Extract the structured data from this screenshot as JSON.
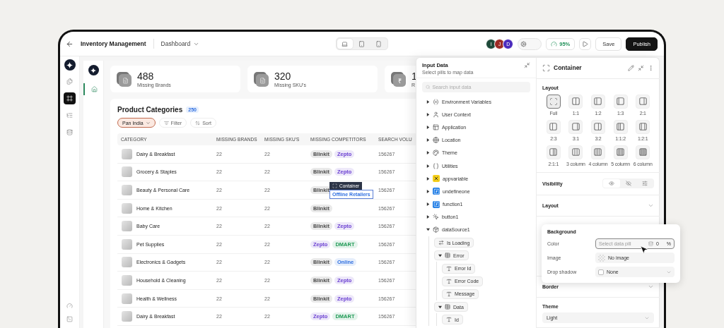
{
  "topbar": {
    "title": "Inventory Management",
    "page": "Dashboard",
    "devices": [
      {
        "selected": true
      },
      {
        "selected": false
      },
      {
        "selected": false
      }
    ],
    "avatars": [
      {
        "initial": "I",
        "color": "#1f4a3a"
      },
      {
        "initial": "J",
        "color": "#9c2a25"
      },
      {
        "initial": "D",
        "color": "#4b2bbd"
      }
    ],
    "settings_toggle_on": false,
    "score": "95%",
    "save": "Save",
    "publish": "Publish"
  },
  "rail": [
    {
      "selected": false
    },
    {
      "selected": true
    },
    {
      "selected": false
    },
    {
      "selected": false
    }
  ],
  "app_nav": [
    {
      "selected": true
    }
  ],
  "stats": [
    {
      "kind": "doc",
      "value": "488",
      "label": "Missing Brands"
    },
    {
      "kind": "doc",
      "value": "320",
      "label": "Missing SKU's"
    },
    {
      "kind": "currency",
      "symbol": "₹",
      "value": "1",
      "label": "R"
    }
  ],
  "table": {
    "title": "Product Categories",
    "count": "250",
    "filters": [
      {
        "kind": "region",
        "label": "Pan India"
      },
      {
        "kind": "filter",
        "label": "Filter"
      },
      {
        "kind": "sort",
        "label": "Sort"
      }
    ],
    "columns": [
      "CATEGORY",
      "MISSING BRANDS",
      "MISSING SKU'S",
      "MISSING COMPETITORS",
      "SEARCH VOLU"
    ],
    "rows": [
      {
        "category": "Dairy & Breakfast",
        "brands": "22",
        "skus": "22",
        "competitors": [
          {
            "name": "Blinkit",
            "color": "#4a4a4a"
          },
          {
            "name": "Zepto",
            "color": "#6a3fd1"
          }
        ],
        "volume": "156267"
      },
      {
        "category": "Grocery & Staples",
        "brands": "22",
        "skus": "22",
        "competitors": [
          {
            "name": "Blinkit",
            "color": "#4a4a4a"
          },
          {
            "name": "Zepto",
            "color": "#6a3fd1"
          }
        ],
        "volume": "156267"
      },
      {
        "category": "Beauty & Personal Care",
        "brands": "22",
        "skus": "22",
        "competitors": [
          {
            "name": "Blinkit",
            "color": "#4a4a4a"
          }
        ],
        "overlay": {
          "label": "Container",
          "tag": "Offline Retailers"
        },
        "volume": "156267"
      },
      {
        "category": "Home & Kitchen",
        "brands": "22",
        "skus": "22",
        "competitors": [
          {
            "name": "Blinkit",
            "color": "#4a4a4a"
          }
        ],
        "volume": "156267"
      },
      {
        "category": "Baby Care",
        "brands": "22",
        "skus": "22",
        "competitors": [
          {
            "name": "Blinkit",
            "color": "#4a4a4a"
          },
          {
            "name": "Zepto",
            "color": "#6a3fd1"
          }
        ],
        "volume": "156267"
      },
      {
        "category": "Pet Supplies",
        "brands": "22",
        "skus": "22",
        "competitors": [
          {
            "name": "Zepto",
            "color": "#6a3fd1"
          },
          {
            "name": "DMART",
            "color": "#1f9a55"
          }
        ],
        "volume": "156267"
      },
      {
        "category": "Electronics & Gadgets",
        "brands": "22",
        "skus": "22",
        "competitors": [
          {
            "name": "Blinkit",
            "color": "#4a4a4a"
          },
          {
            "name": "Online",
            "color": "#2f6fe0"
          }
        ],
        "volume": "156267"
      },
      {
        "category": "Household & Cleaning",
        "brands": "22",
        "skus": "22",
        "competitors": [
          {
            "name": "Blinkit",
            "color": "#4a4a4a"
          },
          {
            "name": "Zepto",
            "color": "#6a3fd1"
          }
        ],
        "volume": "156267"
      },
      {
        "category": "Health & Wellness",
        "brands": "22",
        "skus": "22",
        "competitors": [
          {
            "name": "Blinkit",
            "color": "#4a4a4a"
          },
          {
            "name": "Zepto",
            "color": "#6a3fd1"
          }
        ],
        "volume": "156267"
      },
      {
        "category": "Dairy & Breakfast",
        "brands": "22",
        "skus": "22",
        "competitors": [
          {
            "name": "Zepto",
            "color": "#6a3fd1"
          },
          {
            "name": "DMART",
            "color": "#1f9a55"
          }
        ],
        "volume": "156267"
      }
    ]
  },
  "input_data": {
    "title": "Input Data",
    "subtitle": "Select pills to map data",
    "search_placeholder": "Search input data",
    "tree": [
      {
        "kind": "variable",
        "label": "Environment Variables",
        "expanded": false
      },
      {
        "kind": "user",
        "label": "User Context",
        "expanded": false
      },
      {
        "kind": "app",
        "label": "Application",
        "expanded": false
      },
      {
        "kind": "globe",
        "label": "Location",
        "expanded": false
      },
      {
        "kind": "palette",
        "label": "Theme",
        "expanded": false
      },
      {
        "kind": "braces",
        "label": "Utilities",
        "expanded": false
      },
      {
        "kind": "appvar",
        "label": "appvariable",
        "expanded": false
      },
      {
        "kind": "func",
        "label": "undefineone",
        "expanded": false
      },
      {
        "kind": "func",
        "label": "function1",
        "expanded": false
      },
      {
        "kind": "button",
        "label": "button1",
        "expanded": false
      },
      {
        "kind": "cube",
        "label": "dataSource1",
        "expanded": true,
        "children": [
          {
            "kind": "toggle",
            "label": "Is Loading"
          },
          {
            "kind": "table",
            "label": "Error",
            "expanded": true,
            "children": [
              {
                "kind": "text",
                "label": "Error Id"
              },
              {
                "kind": "text",
                "label": "Error Code"
              },
              {
                "kind": "text",
                "label": "Message"
              }
            ]
          },
          {
            "kind": "table",
            "label": "Data",
            "expanded": true,
            "children": [
              {
                "kind": "text",
                "label": "Id"
              }
            ]
          }
        ]
      }
    ]
  },
  "container": {
    "title": "Container",
    "layout_label": "Layout",
    "layouts": [
      {
        "label": "Full",
        "selected": true
      },
      {
        "label": "1:1",
        "selected": false
      },
      {
        "label": "1:2",
        "selected": false
      },
      {
        "label": "1:3",
        "selected": false
      },
      {
        "label": "2:1",
        "selected": false
      },
      {
        "label": "2:3",
        "selected": false
      },
      {
        "label": "3:1",
        "selected": false
      },
      {
        "label": "3:2",
        "selected": false
      },
      {
        "label": "1:1:2",
        "selected": false
      },
      {
        "label": "1:2:1",
        "selected": false
      },
      {
        "label": "2:1:1",
        "selected": false
      },
      {
        "label": "3 column",
        "selected": false
      },
      {
        "label": "4 column",
        "selected": false
      },
      {
        "label": "5 column",
        "selected": false
      },
      {
        "label": "6 column",
        "selected": false
      }
    ],
    "sections": [
      {
        "kind": "visibility",
        "label": "Visibility",
        "options": [
          {
            "selected": true
          },
          {
            "selected": false
          },
          {
            "selected": false
          }
        ]
      },
      {
        "kind": "collapsible",
        "label": "Layout"
      },
      {
        "kind": "hidden"
      },
      {
        "kind": "collapsible",
        "label": "Border"
      },
      {
        "kind": "select",
        "label": "Theme",
        "value": "Light"
      }
    ]
  },
  "background_popover": {
    "title": "Background",
    "rows": [
      {
        "kind": "data",
        "label": "Color",
        "placeholder": "Select data pill",
        "value": "0",
        "unit": "%"
      },
      {
        "kind": "image",
        "label": "Image",
        "value": "No image"
      },
      {
        "kind": "checkbox",
        "label": "Drop shadow",
        "checked": false,
        "value": "None"
      }
    ]
  }
}
